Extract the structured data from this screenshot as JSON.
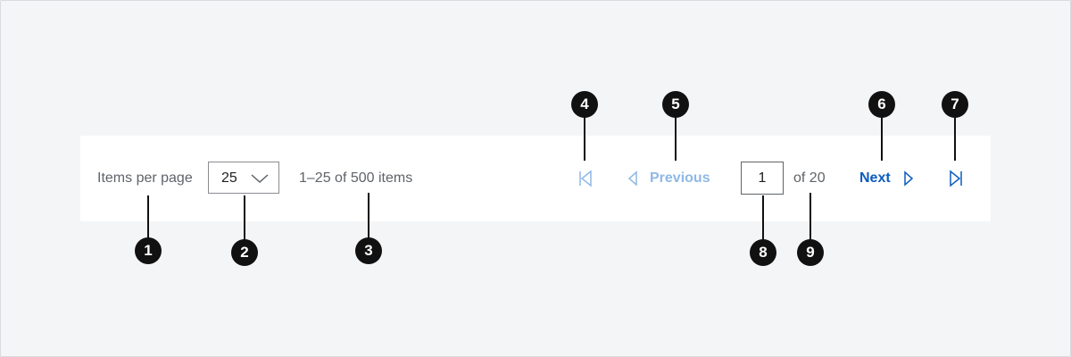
{
  "pagination": {
    "items_per_page_label": "Items per page",
    "items_per_page_value": "25",
    "range_text": "1–25 of 500 items",
    "previous_label": "Previous",
    "next_label": "Next",
    "current_page": "1",
    "total_pages_text": "of 20"
  },
  "icons": {
    "dropdown": "chevron-down-icon",
    "first_page": "first-page-icon",
    "previous": "caret-left-icon",
    "next": "caret-right-icon",
    "last_page": "last-page-icon"
  },
  "colors": {
    "enabled_link": "#0b5cbf",
    "disabled_link": "#8fb8e6",
    "background": "#f4f5f7",
    "panel": "#ffffff",
    "callout": "#111111"
  },
  "callouts": [
    "1",
    "2",
    "3",
    "4",
    "5",
    "6",
    "7",
    "8",
    "9"
  ]
}
